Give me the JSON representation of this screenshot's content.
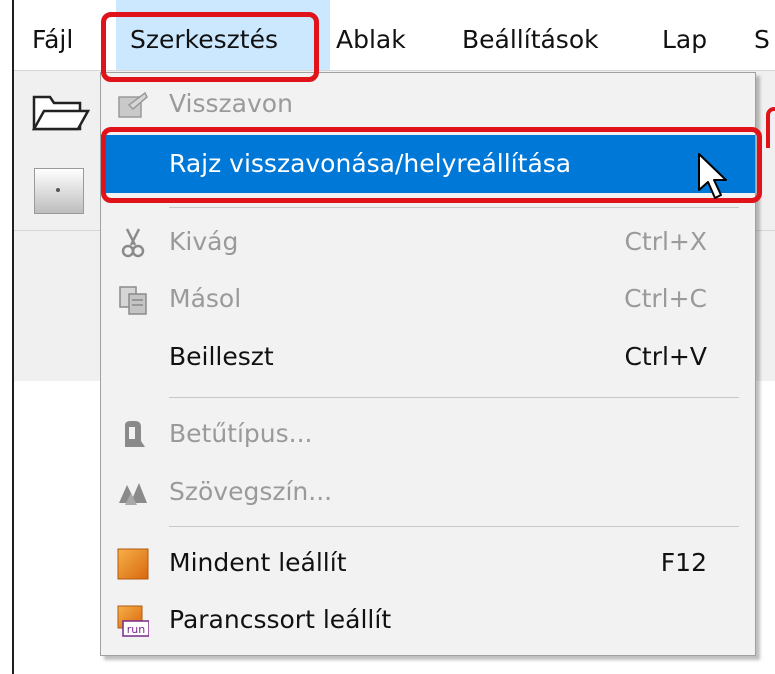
{
  "menubar": {
    "items": [
      {
        "label": "Fájl"
      },
      {
        "label": "Szerkesztés"
      },
      {
        "label": "Ablak"
      },
      {
        "label": "Beállítások"
      },
      {
        "label": "Lap"
      },
      {
        "label": "S"
      }
    ]
  },
  "edit_menu": {
    "items": [
      {
        "label": "Visszavon",
        "shortcut": "",
        "enabled": false,
        "icon": "undo-icon"
      },
      {
        "label": "Rajz visszavonása/helyreállítása",
        "shortcut": "",
        "enabled": true,
        "highlighted": true
      },
      {
        "label": "Kivág",
        "shortcut": "Ctrl+X",
        "enabled": false,
        "icon": "scissors-icon"
      },
      {
        "label": "Másol",
        "shortcut": "Ctrl+C",
        "enabled": false,
        "icon": "copy-icon"
      },
      {
        "label": "Beilleszt",
        "shortcut": "Ctrl+V",
        "enabled": true
      },
      {
        "label": "Betűtípus...",
        "shortcut": "",
        "enabled": false,
        "icon": "font-icon"
      },
      {
        "label": "Szövegszín...",
        "shortcut": "",
        "enabled": false,
        "icon": "text-color-icon"
      },
      {
        "label": "Mindent leállít",
        "shortcut": "F12",
        "enabled": true,
        "icon": "stop-all-icon"
      },
      {
        "label": "Parancssort leállít",
        "shortcut": "",
        "enabled": true,
        "icon": "stop-command-icon",
        "icon_text": "run"
      }
    ]
  },
  "colors": {
    "highlight": "#0078d7",
    "annotation": "#e0131b",
    "disabled_text": "#9a9a9a"
  }
}
